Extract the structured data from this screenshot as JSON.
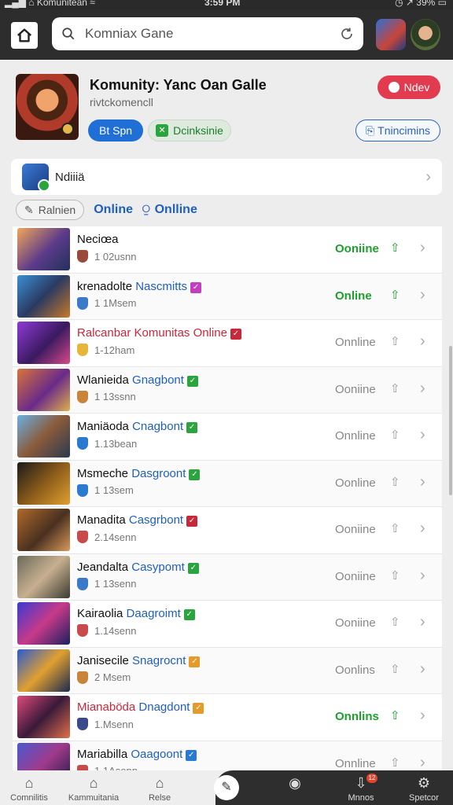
{
  "status_bar": {
    "carrier": "Komunitean",
    "time": "3:59 PM",
    "battery": "39%"
  },
  "search": {
    "value": "Komniax Gane"
  },
  "header": {
    "title": "Komunity: Yanc Oan Galle",
    "subtitle": "rivtckomencll",
    "new_button": "Ndev",
    "pill_primary": "Bt Spn",
    "pill_secondary": "Dcinksinie",
    "pill_outline": "Tnincimins"
  },
  "notification": {
    "label": "Ndiiiä"
  },
  "filters": {
    "chip": "Ralnien",
    "link1": "Online",
    "link2": "Onlline"
  },
  "games": [
    {
      "name": "Neciœa",
      "highlight": "",
      "meta": "1 02usnn",
      "status": "Ooniine",
      "online": true,
      "title_style": "normal",
      "tag_color": "",
      "shield_color": "#9a4a3a",
      "thumb": "linear-gradient(135deg,#f2a65a,#5b3a8a 55%,#23305a)"
    },
    {
      "name": "krenadolte ",
      "highlight": "Nascmitts",
      "meta": "1 1Msem",
      "status": "Online",
      "online": true,
      "title_style": "normal",
      "tag_color": "#c43ec0",
      "shield_color": "#3a7ac8",
      "thumb": "linear-gradient(135deg,#3b8fd6,#2a3a60 50%,#c87a2a)"
    },
    {
      "name": "Ralcanbar Komunitas Online",
      "highlight": "",
      "meta": "1-12ham",
      "status": "Onnline",
      "online": false,
      "title_style": "red",
      "tag_color": "#c9283b",
      "shield_color": "#e6b63a",
      "thumb": "linear-gradient(135deg,#8e3ad6,#3a1a60 55%,#d84a8a)"
    },
    {
      "name": "Wlanieida ",
      "highlight": "Gnagbont",
      "meta": "1 13ssnn",
      "status": "Ooniine",
      "online": false,
      "title_style": "normal",
      "tag_color": "#2aa43c",
      "shield_color": "#c8853a",
      "thumb": "linear-gradient(135deg,#d8743a,#6a2a8a 55%,#e0b04a)"
    },
    {
      "name": "Maniäoda ",
      "highlight": "Cnagbont",
      "meta": "1.13bean",
      "status": "Onnline",
      "online": false,
      "title_style": "normal",
      "tag_color": "#2aa43c",
      "shield_color": "#2a7ad0",
      "thumb": "linear-gradient(135deg,#6ab0e0,#8a5a3a 50%,#2a3a50)"
    },
    {
      "name": "Msmeche ",
      "highlight": "Dasgroont",
      "meta": "1 13sem",
      "status": "Oonline",
      "online": false,
      "title_style": "normal",
      "tag_color": "#2aa43c",
      "shield_color": "#2a7ad0",
      "thumb": "linear-gradient(135deg,#1a1a1a,#8a5a1a 50%,#e0a030)"
    },
    {
      "name": "Manadita ",
      "highlight": "Casgrbont",
      "meta": "2.14senn",
      "status": "Ooniine",
      "online": false,
      "title_style": "normal",
      "tag_color": "#c9283b",
      "shield_color": "#c84a4a",
      "thumb": "linear-gradient(135deg,#b06a2a,#4a3020 55%,#d89a5a)"
    },
    {
      "name": "Jeandalta ",
      "highlight": "Casypomt",
      "meta": "1 13senn",
      "status": "Ooniine",
      "online": false,
      "title_style": "normal",
      "tag_color": "#2aa43c",
      "shield_color": "#3a7ac8",
      "thumb": "linear-gradient(135deg,#6a6a5a,#c8b090 50%,#3a3a30)"
    },
    {
      "name": "Kairaolia ",
      "highlight": "Daagroimt",
      "meta": "1.14senn",
      "status": "Ooniine",
      "online": false,
      "title_style": "normal",
      "tag_color": "#2aa43c",
      "shield_color": "#c84a4a",
      "thumb": "linear-gradient(135deg,#3a3ad0,#c83a8a 50%,#1a2060)"
    },
    {
      "name": "Janisecile ",
      "highlight": "Snagrocnt",
      "meta": "2 Msem",
      "status": "Oonlins",
      "online": false,
      "title_style": "normal",
      "tag_color": "#e69a2a",
      "shield_color": "#c8853a",
      "thumb": "linear-gradient(135deg,#2a5ad0,#e0a030 50%,#1a2a50)"
    },
    {
      "name": "Mianaböda ",
      "highlight": "Dnagdont",
      "meta": "1.Msenn",
      "status": "Onnlins",
      "online": true,
      "title_style": "red",
      "tag_color": "#e69a2a",
      "shield_color": "#3a4a8a",
      "thumb": "linear-gradient(135deg,#e04a7a,#3a1a3a 50%,#e0704a)"
    },
    {
      "name": "Mariabilla ",
      "highlight": "Oaagoont",
      "meta": "1.1Asenn",
      "status": "Onnline",
      "online": false,
      "title_style": "normal",
      "tag_color": "#2a7ad0",
      "shield_color": "#c84a4a",
      "thumb": "linear-gradient(135deg,#4a5ad0,#a03a8a 50%,#1a1a40)"
    }
  ],
  "bottom_nav": [
    {
      "label": "Comnilitis",
      "icon": "home-icon"
    },
    {
      "label": "Kammuitania",
      "icon": "home-icon"
    },
    {
      "label": "Relse",
      "icon": "home-icon"
    },
    {
      "label": "Mnnos",
      "icon": "inbox-icon",
      "badge": "12"
    },
    {
      "label": "Spetcor",
      "icon": "gear-icon"
    }
  ]
}
